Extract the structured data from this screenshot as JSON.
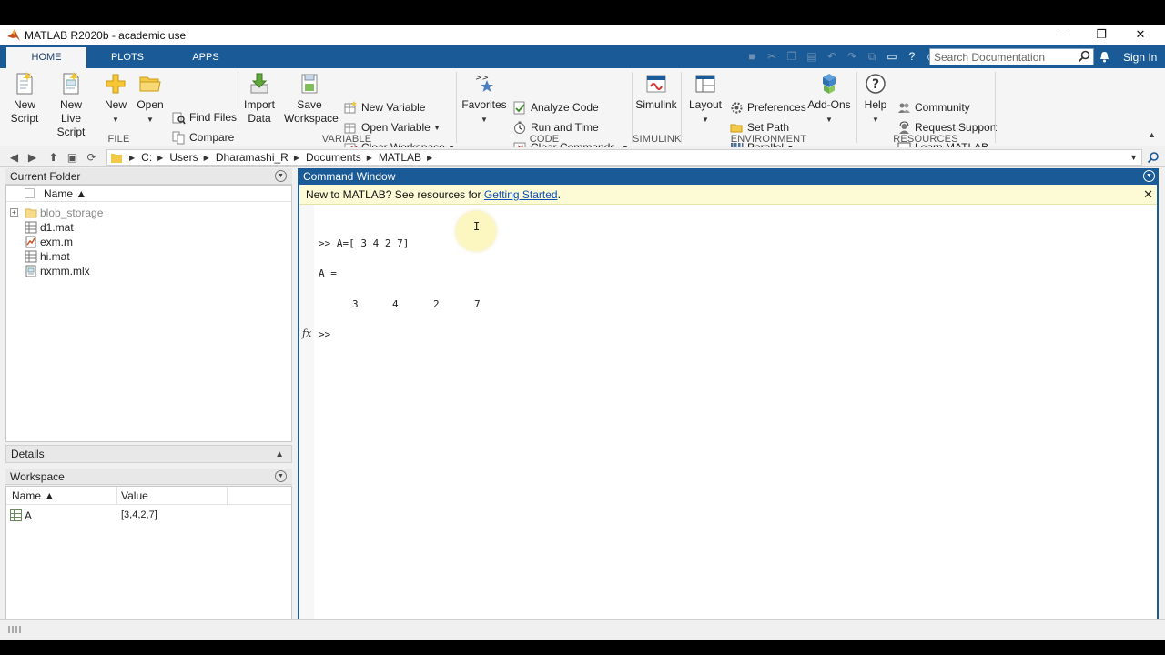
{
  "window": {
    "title": "MATLAB R2020b - academic use",
    "controls": {
      "minimize": "—",
      "restore": "❐",
      "close": "✕"
    }
  },
  "ribbon_tabs": [
    "HOME",
    "PLOTS",
    "APPS"
  ],
  "active_tab": "HOME",
  "search": {
    "placeholder": "Search Documentation"
  },
  "sign_in": "Sign In",
  "ribbon": {
    "file": {
      "label": "FILE",
      "new_script": [
        "New",
        "Script"
      ],
      "new_live_script": [
        "New",
        "Live Script"
      ],
      "new": "New",
      "open": "Open",
      "find_files": "Find Files",
      "compare": "Compare"
    },
    "variable": {
      "label": "VARIABLE",
      "import_data": [
        "Import",
        "Data"
      ],
      "save_workspace": [
        "Save",
        "Workspace"
      ],
      "new_variable": "New Variable",
      "open_variable": "Open Variable",
      "clear_workspace": "Clear Workspace"
    },
    "code": {
      "label": "CODE",
      "favorites": "Favorites",
      "analyze_code": "Analyze Code",
      "run_and_time": "Run and Time",
      "clear_commands": "Clear Commands"
    },
    "simulink": {
      "label": "SIMULINK",
      "simulink": "Simulink"
    },
    "environment": {
      "label": "ENVIRONMENT",
      "layout": "Layout",
      "preferences": "Preferences",
      "set_path": "Set Path",
      "parallel": "Parallel",
      "add_ons": "Add-Ons"
    },
    "resources": {
      "label": "RESOURCES",
      "help": "Help",
      "community": "Community",
      "request_support": "Request Support",
      "learn_matlab": "Learn MATLAB"
    }
  },
  "path": [
    "C:",
    "Users",
    "Dharamashi_R",
    "Documents",
    "MATLAB"
  ],
  "current_folder": {
    "title": "Current Folder",
    "name_col": "Name ▲",
    "files": [
      {
        "name": "blob_storage",
        "type": "folder"
      },
      {
        "name": "d1.mat",
        "type": "mat"
      },
      {
        "name": "exm.m",
        "type": "m"
      },
      {
        "name": "hi.mat",
        "type": "mat"
      },
      {
        "name": "nxmm.mlx",
        "type": "mlx"
      }
    ]
  },
  "details": {
    "title": "Details"
  },
  "workspace": {
    "title": "Workspace",
    "name_col": "Name ▲",
    "value_col": "Value",
    "variables": [
      {
        "name": "A",
        "value": "[3,4,2,7]"
      }
    ]
  },
  "command_window": {
    "title": "Command Window",
    "notice_text": "New to MATLAB? See resources for ",
    "notice_link": "Getting Started",
    "notice_end": ".",
    "line1": ">> A=[ 3 4 2 7]",
    "output_label": "A =",
    "output_values": [
      "3",
      "4",
      "2",
      "7"
    ],
    "prompt": ">>",
    "fx": "fx"
  }
}
